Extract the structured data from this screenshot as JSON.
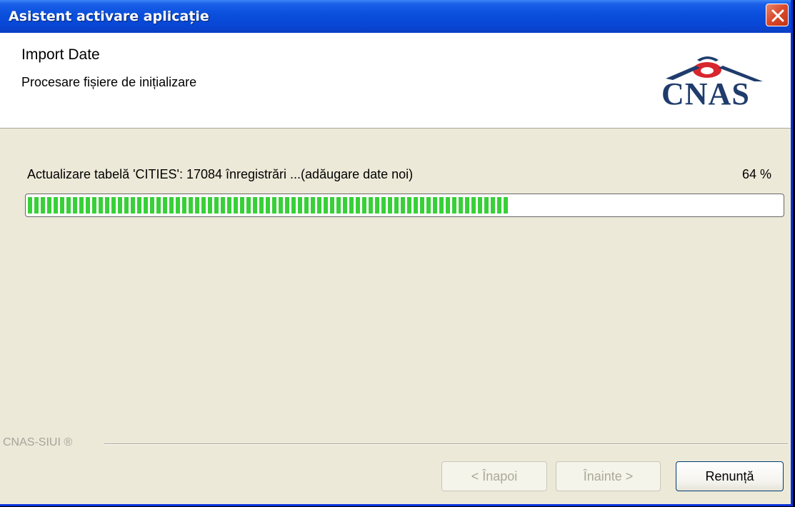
{
  "window": {
    "title": "Asistent activare aplicație"
  },
  "header": {
    "title": "Import Date",
    "subtitle": "Procesare fișiere de inițializare",
    "logo_text": "CNAS"
  },
  "progress": {
    "status": "Actualizare tabelă 'CITIES': 17084 înregistrări ...(adăugare date noi)",
    "percent_label": "64 %",
    "fraction": 0.64,
    "fill_color": "#38d038"
  },
  "footer": {
    "brand": "CNAS-SIUI ®",
    "back_label": "< Înapoi",
    "next_label": "Înainte >",
    "cancel_label": "Renunță"
  },
  "icons": {
    "close": "close-icon",
    "logo": "cnas-logo"
  },
  "colors": {
    "titlebar": "#0a4fdc",
    "close": "#d9482a",
    "logo": "#1f3c6c",
    "logo_accent": "#d8262e"
  }
}
